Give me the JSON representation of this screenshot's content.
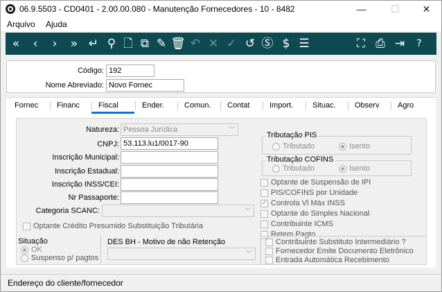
{
  "window": {
    "title": "06.9.5503 - CD0401 - 2.00.00.080 - Manutenção Fornecedores - 10 - 8482"
  },
  "titlebar": {
    "minimize": "—",
    "maximize": "☐",
    "close": "✕"
  },
  "menu": {
    "items": [
      "Arquivo",
      "Ajuda"
    ]
  },
  "toolbar": {
    "icons": [
      "first-icon",
      "previous-icon",
      "next-icon",
      "last-icon",
      "enter-icon",
      "search-icon",
      "new-document-icon",
      "copy-document-icon",
      "edit-icon",
      "delete-icon",
      "undo-icon",
      "cancel-icon",
      "confirm-icon",
      "history-icon",
      "currency-icon",
      "dollar-icon",
      "list-icon",
      "sitemap-icon",
      "print-icon",
      "exit-icon",
      "help-icon"
    ],
    "glyphs": [
      "«",
      "‹",
      "›",
      "»",
      "↵",
      "⚲",
      "🗋",
      "⧉",
      "✎",
      "🗑",
      "↶",
      "✕",
      "✓",
      "↺",
      "Ⓢ",
      "$",
      "☰",
      "⛶",
      "⎙",
      "⇥",
      "?"
    ]
  },
  "header": {
    "codigo_label": "Código:",
    "codigo_value": "192",
    "nome_label": "Nome Abreviado:",
    "nome_value": "Novo Fornec"
  },
  "tabs": [
    "Fornec",
    "Financ",
    "Fiscal",
    "Ender.",
    "Comun.",
    "Contat",
    "Import.",
    "Situac.",
    "Observ",
    "Agro"
  ],
  "active_tab": "Fiscal",
  "fiscal": {
    "natureza_label": "Natureza:",
    "natureza_value": "Pessoa Jurídica",
    "cnpj_label": "CNPJ:",
    "cnpj_value": "53.113.lu1/0017-90",
    "insc_municipal_label": "Inscrição Municipal:",
    "insc_municipal_value": "",
    "insc_estadual_label": "Inscrição Estadual:",
    "insc_estadual_value": "",
    "insc_inss_label": "Inscrição INSS/CEI:",
    "insc_inss_value": "",
    "passaporte_label": "Nr Passaporte:",
    "passaporte_value": "",
    "categoria_label": "Categoria SCANC:",
    "categoria_value": "",
    "optante_credito_label": "Optante Crédito Presumido Substituição Tributária",
    "tributacao_pis": {
      "title": "Tributação PIS",
      "opt1": "Tributado",
      "opt2": "Isento",
      "selected": "Isento"
    },
    "tributacao_cofins": {
      "title": "Tributação COFINS",
      "opt1": "Tributado",
      "opt2": "Isento",
      "selected": "Isento"
    },
    "checks": [
      {
        "label": "Optante de Suspensão de IPI",
        "checked": false
      },
      {
        "label": "PIS/COFINS por Unidade",
        "checked": false
      },
      {
        "label": "Controla Vl Máx INSS",
        "checked": true
      },
      {
        "label": "Optante do Simples Nacional",
        "checked": false
      },
      {
        "label": "Contribuinte ICMS",
        "checked": false
      },
      {
        "label": "Retem Pagto",
        "checked": false
      }
    ],
    "situacao": {
      "title": "Situação",
      "opt1": "OK",
      "opt2": "Suspenso p/ pagtos",
      "selected": "OK"
    },
    "des_bh": {
      "label": "DES BH - Motivo de não Retenção",
      "value": ""
    },
    "checks2": [
      {
        "label": "Contribuinte Substituto Intermediário ?",
        "checked": false
      },
      {
        "label": "Fornecedor Emite Documento Eletrônico",
        "checked": false
      },
      {
        "label": "Entrada Automática Recebimento",
        "checked": false
      }
    ]
  },
  "status": {
    "text": "Endereço do cliente/fornecedor"
  }
}
